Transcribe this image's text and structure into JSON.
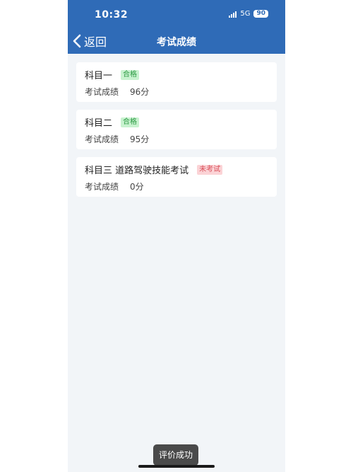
{
  "status_bar": {
    "time": "10:32",
    "network": "5G",
    "battery": "90"
  },
  "header": {
    "back_label": "返回",
    "title": "考试成绩"
  },
  "results": [
    {
      "subject": "科目一",
      "status": "合格",
      "status_type": "pass",
      "score_label": "考试成绩",
      "score": "96分"
    },
    {
      "subject": "科目二",
      "status": "合格",
      "status_type": "pass",
      "score_label": "考试成绩",
      "score": "95分"
    },
    {
      "subject": "科目三 道路驾驶技能考试",
      "status": "未考试",
      "status_type": "fail",
      "score_label": "考试成绩",
      "score": "0分"
    }
  ],
  "toast": {
    "message": "评价成功"
  },
  "colors": {
    "header": "#2f6bb7",
    "background": "#f2f5f8",
    "pass_bg": "#c8f2cf",
    "pass_text": "#2e9b45",
    "fail_bg": "#fbd3d6",
    "fail_text": "#d9505a"
  }
}
